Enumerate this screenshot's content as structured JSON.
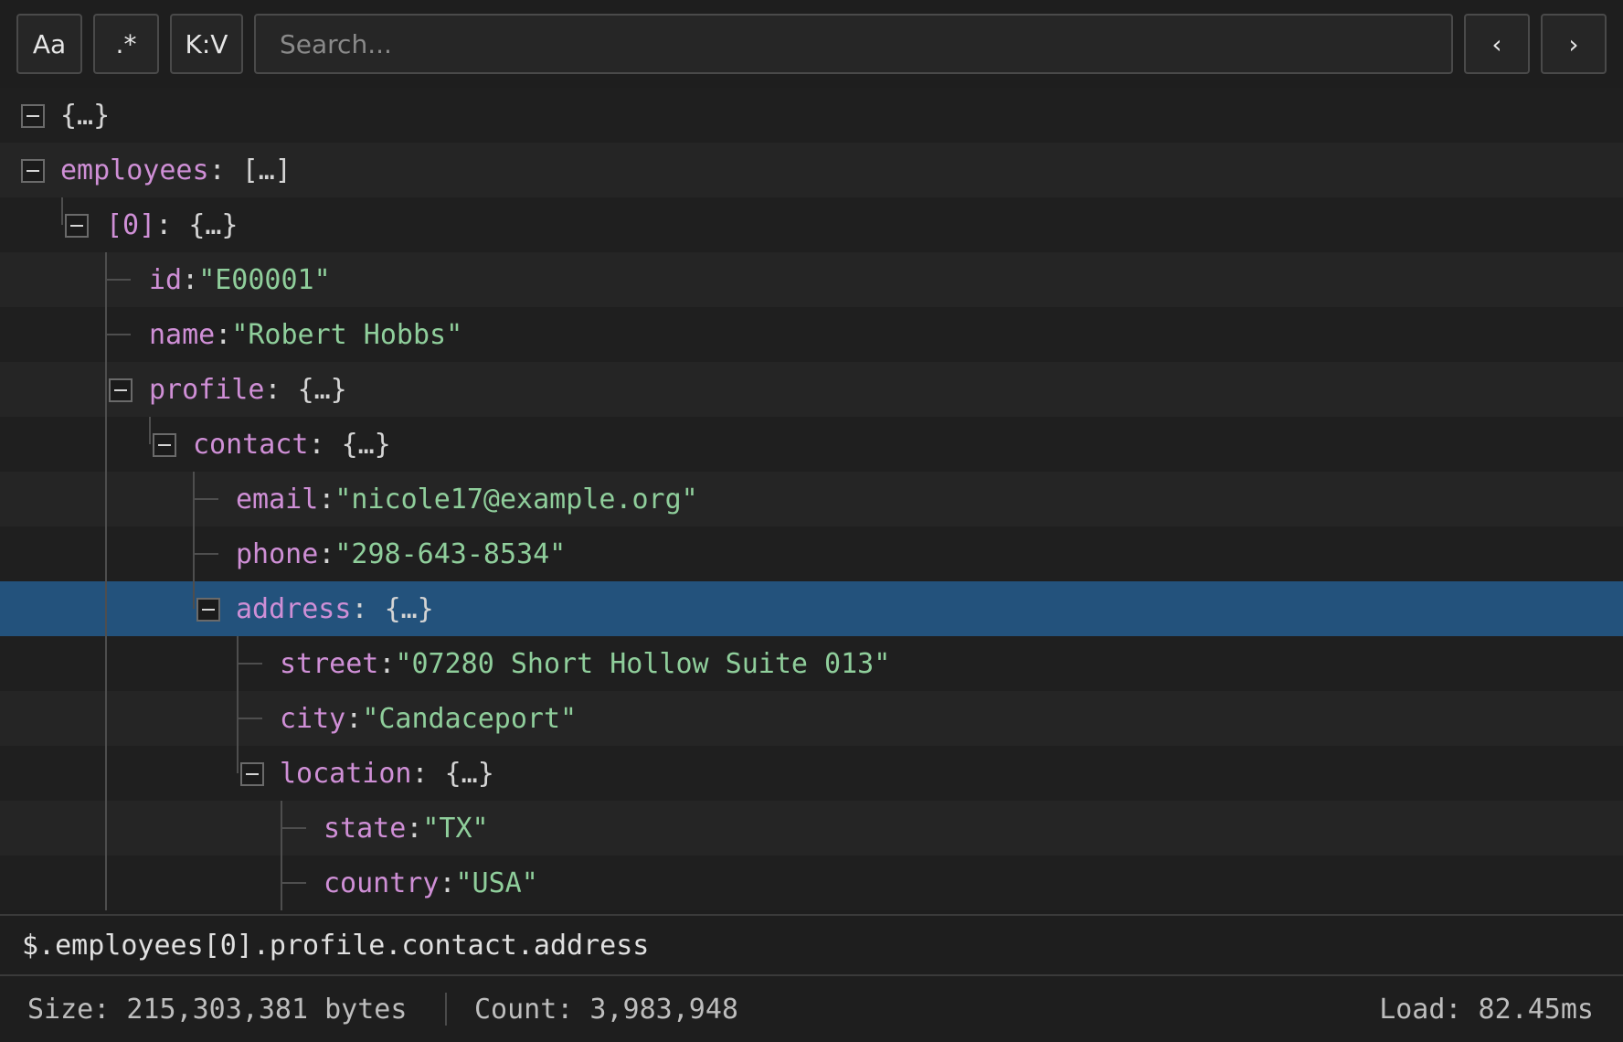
{
  "toolbar": {
    "case_label": "Aa",
    "regex_label": ".*",
    "kv_label": "K:V",
    "search_placeholder": "Search...",
    "search_value": "",
    "prev_label": "‹",
    "next_label": "›"
  },
  "tree": [
    {
      "key": "",
      "value": "{…}",
      "type": "object",
      "expanded": true
    },
    {
      "key": "employees",
      "value": "[…]",
      "type": "array",
      "expanded": true
    },
    {
      "key": "[0]",
      "value": "{…}",
      "type": "object",
      "expanded": true
    },
    {
      "key": "id",
      "value": "\"E00001\"",
      "type": "string"
    },
    {
      "key": "name",
      "value": "\"Robert Hobbs\"",
      "type": "string"
    },
    {
      "key": "profile",
      "value": "{…}",
      "type": "object",
      "expanded": true
    },
    {
      "key": "contact",
      "value": "{…}",
      "type": "object",
      "expanded": true
    },
    {
      "key": "email",
      "value": "\"nicole17@example.org\"",
      "type": "string"
    },
    {
      "key": "phone",
      "value": "\"298-643-8534\"",
      "type": "string"
    },
    {
      "key": "address",
      "value": "{…}",
      "type": "object",
      "expanded": true,
      "selected": true
    },
    {
      "key": "street",
      "value": "\"07280 Short Hollow Suite 013\"",
      "type": "string"
    },
    {
      "key": "city",
      "value": "\"Candaceport\"",
      "type": "string"
    },
    {
      "key": "location",
      "value": "{…}",
      "type": "object",
      "expanded": true
    },
    {
      "key": "state",
      "value": "\"TX\"",
      "type": "string"
    },
    {
      "key": "country",
      "value": "\"USA\"",
      "type": "string"
    }
  ],
  "path": "$.employees[0].profile.contact.address",
  "status": {
    "size": "Size: 215,303,381 bytes",
    "count": "Count: 3,983,948",
    "load": "Load: 82.45ms"
  },
  "colors": {
    "key": "#cf8fd6",
    "string": "#8fce9b",
    "selection": "#23527c"
  }
}
